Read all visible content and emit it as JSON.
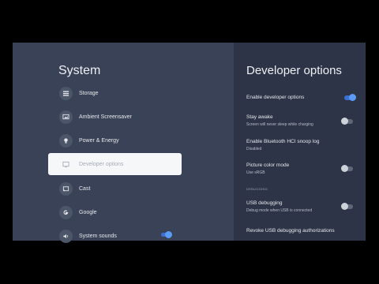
{
  "system_panel": {
    "title": "System",
    "items": [
      {
        "label": "Storage",
        "icon": "storage-icon"
      },
      {
        "label": "Ambient Screensaver",
        "icon": "screensaver-icon"
      },
      {
        "label": "Power & Energy",
        "icon": "power-icon"
      },
      {
        "label": "Developer options",
        "icon": "developer-icon",
        "selected": true
      },
      {
        "label": "Cast",
        "icon": "cast-icon"
      },
      {
        "label": "Google",
        "icon": "google-icon"
      },
      {
        "label": "System sounds",
        "icon": "sound-icon",
        "toggle_on": true
      }
    ]
  },
  "developer_panel": {
    "title": "Developer options",
    "options": [
      {
        "title": "Enable developer options",
        "subtitle": "",
        "toggle": "on"
      },
      {
        "title": "Stay awake",
        "subtitle": "Screen will never sleep while charging",
        "toggle": "off"
      },
      {
        "title": "Enable Bluetooth HCI snoop log",
        "subtitle": "Disabled",
        "toggle": null
      },
      {
        "title": "Picture color mode",
        "subtitle": "Use sRGB",
        "toggle": "off"
      },
      {
        "title": "USB debugging",
        "subtitle": "Debug mode when USB is connected",
        "toggle": "off"
      },
      {
        "title": "Revoke USB debugging authorizations",
        "subtitle": "",
        "toggle": null
      }
    ],
    "section_debugging": "DEBUGGING"
  },
  "colors": {
    "background": "#394256",
    "right_panel": "#2d3447",
    "accent": "#5b9bf5",
    "selected_item": "#f6f7f9"
  }
}
